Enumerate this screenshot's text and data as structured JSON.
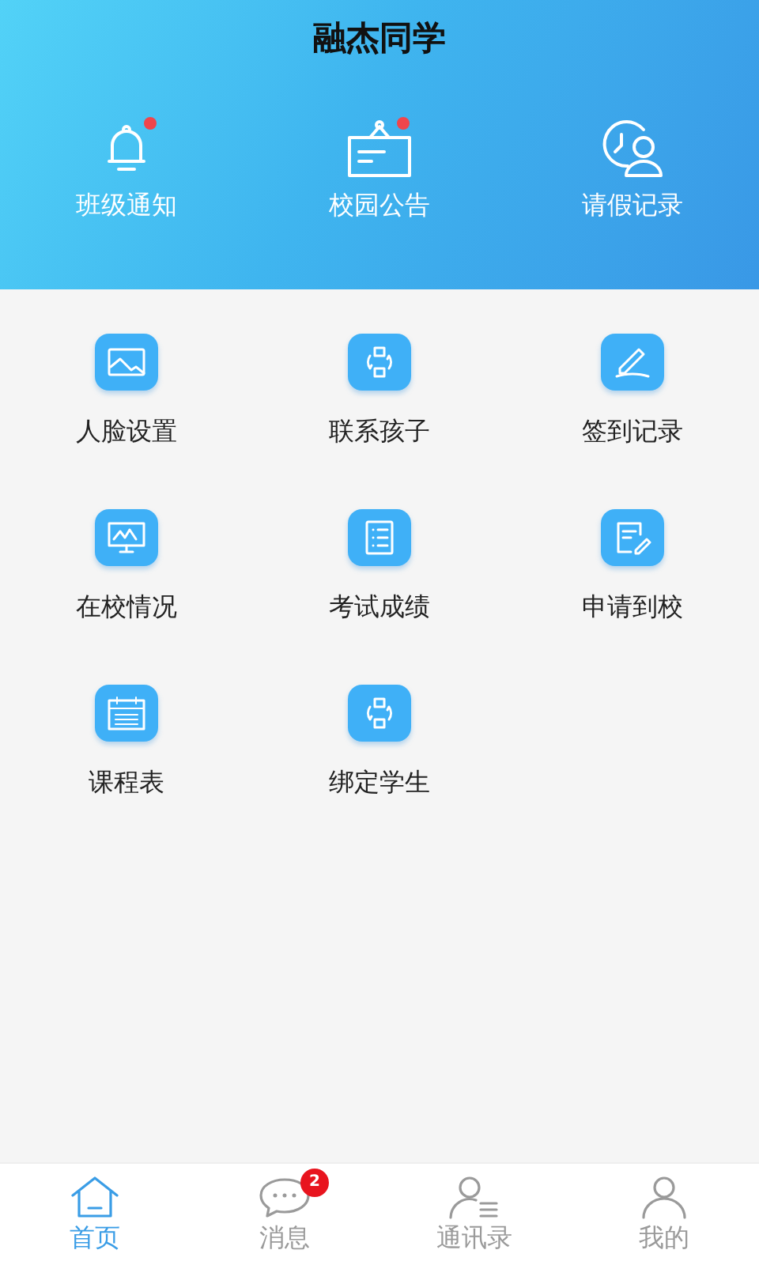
{
  "header": {
    "title": "融杰同学",
    "shortcuts": [
      {
        "label": "班级通知",
        "kind": "bell",
        "unread": true
      },
      {
        "label": "校园公告",
        "kind": "signboard",
        "unread": true
      },
      {
        "label": "请假记录",
        "kind": "leave",
        "unread": false
      }
    ]
  },
  "grid": [
    {
      "label": "人脸设置",
      "kind": "image"
    },
    {
      "label": "联系孩子",
      "kind": "exchange"
    },
    {
      "label": "签到记录",
      "kind": "pen"
    },
    {
      "label": "在校情况",
      "kind": "monitor"
    },
    {
      "label": "考试成绩",
      "kind": "list"
    },
    {
      "label": "申请到校",
      "kind": "form"
    },
    {
      "label": "课程表",
      "kind": "calendar"
    },
    {
      "label": "绑定学生",
      "kind": "exchange"
    }
  ],
  "tab_bar": [
    {
      "label": "首页",
      "kind": "home",
      "selected": true
    },
    {
      "label": "消息",
      "kind": "chat",
      "selected": false,
      "badge": "2"
    },
    {
      "label": "通讯录",
      "kind": "contacts",
      "selected": false
    },
    {
      "label": "我的",
      "kind": "profile",
      "selected": false
    }
  ]
}
